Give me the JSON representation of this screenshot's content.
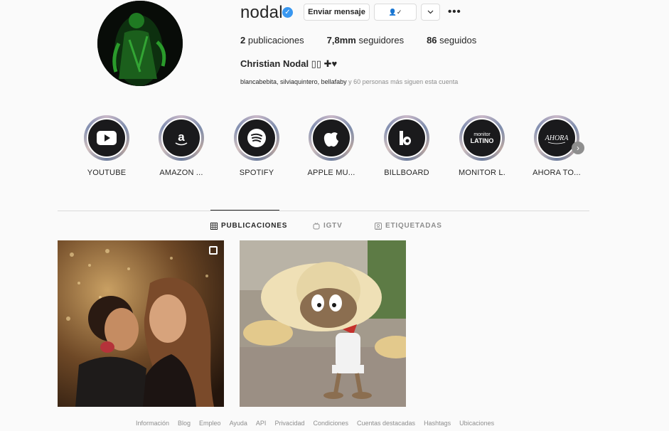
{
  "profile": {
    "username": "nodal",
    "verified_icon": "verified-badge-icon",
    "send_message_label": "Enviar mensaje",
    "follow_label": "👤✓",
    "more_label": "•••",
    "posts_count": "2",
    "posts_label": "publicaciones",
    "followers_count": "7,8mm",
    "followers_label": "seguidores",
    "following_count": "86",
    "following_label": "seguidos",
    "full_name": "Christian Nodal ▯▯ ✚♥",
    "followed_by_names": "blancabebita, silviaquintero, bellafaby",
    "followed_by_more": " y 60 personas más siguen esta cuenta"
  },
  "highlights": [
    {
      "label": "YOUTUBE",
      "icon": "youtube-icon"
    },
    {
      "label": "AMAZON ...",
      "icon": "amazon-icon"
    },
    {
      "label": "SPOTIFY",
      "icon": "spotify-icon"
    },
    {
      "label": "APPLE MU...",
      "icon": "apple-icon"
    },
    {
      "label": "BILLBOARD",
      "icon": "billboard-icon"
    },
    {
      "label": "MONITOR L.",
      "icon": "monitor-latino-icon"
    },
    {
      "label": "AHORA TO...",
      "icon": "ahora-icon"
    }
  ],
  "tabs": [
    {
      "label": "PUBLICACIONES",
      "icon": "grid-icon",
      "active": true
    },
    {
      "label": "IGTV",
      "icon": "igtv-icon",
      "active": false
    },
    {
      "label": "ETIQUETADAS",
      "icon": "tagged-icon",
      "active": false
    }
  ],
  "footer": [
    "Información",
    "Blog",
    "Empleo",
    "Ayuda",
    "API",
    "Privacidad",
    "Condiciones",
    "Cuentas destacadas",
    "Hashtags",
    "Ubicaciones"
  ],
  "colors": {
    "verified": "#3897f0",
    "text": "#262626",
    "muted": "#8e8e8e",
    "border": "#dbdbdb"
  }
}
